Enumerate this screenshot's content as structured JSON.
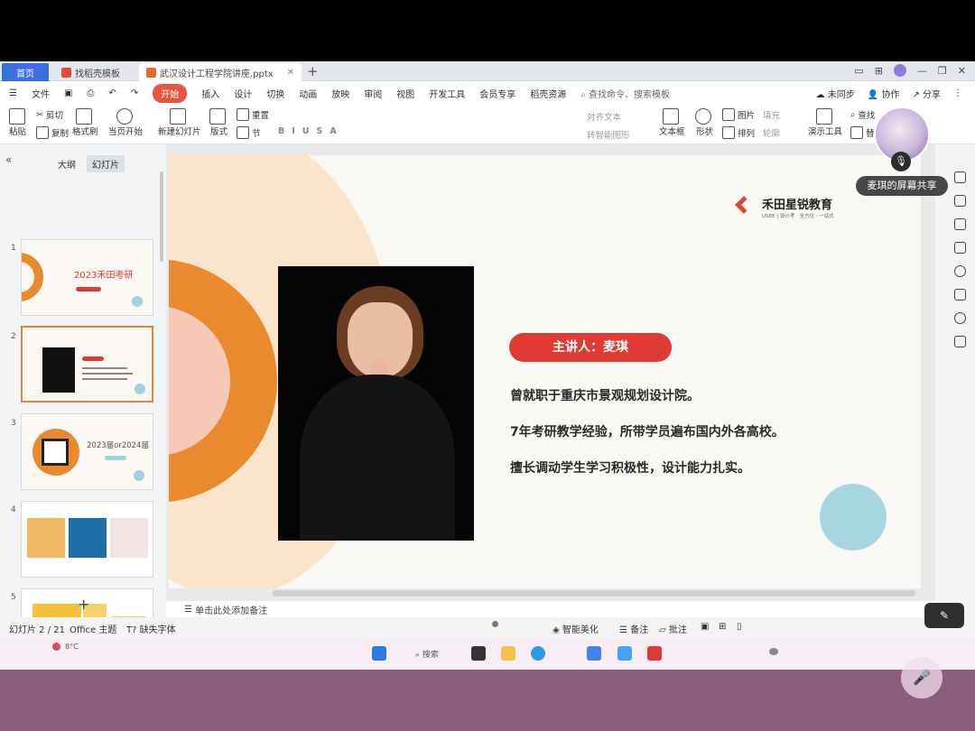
{
  "tabs": {
    "home": "首页",
    "templates": "找稻壳模板",
    "document": "武汉设计工程学院讲座.pptx"
  },
  "menu": {
    "file": "文件",
    "items": [
      "开始",
      "插入",
      "设计",
      "切换",
      "动画",
      "放映",
      "审阅",
      "视图",
      "开发工具",
      "会员专享",
      "稻壳资源"
    ],
    "search": "查找命令、搜索模板",
    "not_synced": "未同步",
    "collaborate": "协作",
    "share": "分享"
  },
  "ribbon": {
    "paste": "粘贴",
    "cut": "剪切",
    "copy": "复制",
    "format_painter": "格式刷",
    "from_current": "当页开始",
    "new_slide": "新建幻灯片",
    "layout": "版式",
    "reset": "重置",
    "section": "节",
    "align_text": "对齐文本",
    "smartart": "转智能图形",
    "textbox": "文本框",
    "shapes": "形状",
    "picture": "图片",
    "fill": "填充",
    "arrange": "排列",
    "outline": "轮廓",
    "present_tools": "演示工具",
    "find": "查找",
    "replace": "替"
  },
  "panel": {
    "outline_tab": "大纲",
    "slides_tab": "幻灯片",
    "slide_numbers": [
      "1",
      "2",
      "3",
      "4",
      "5"
    ],
    "thumb1_title": "2023禾田考研",
    "thumb3_title": "2023届or2024届"
  },
  "slide": {
    "logo_text": "禾田星锐教育",
    "logo_sub": "USEE | 设计考 · 全方位 · 一站式",
    "speaker_badge": "主讲人：麦琪",
    "lines": [
      "曾就职于重庆市景观规划设计院。",
      "7年考研教学经验，所带学员遍布国内外各高校。",
      "擅长调动学生学习积极性，设计能力扎实。"
    ],
    "accent_orange": "#ea8a2e",
    "accent_red": "#e03a34",
    "accent_teal": "#9fd2de"
  },
  "notes": "单击此处添加备注",
  "status": {
    "slide_count": "幻灯片 2 / 21",
    "theme": "Office 主题",
    "font_missing": "缺失字体",
    "beautify": "智能美化",
    "notes_btn": "备注",
    "comments": "批注"
  },
  "overlay": {
    "screen_share_label": "麦琪的屏幕共享"
  },
  "taskbar": {
    "weather_temp": "8°C",
    "search_hint": "搜索"
  }
}
